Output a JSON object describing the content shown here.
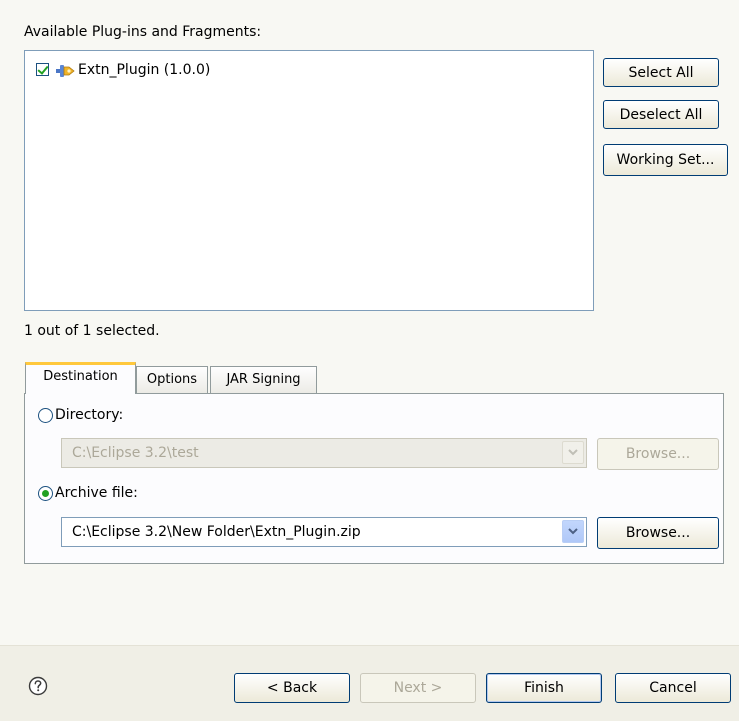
{
  "plugins": {
    "heading": "Available Plug-ins and Fragments:",
    "items": [
      {
        "label": "Extn_Plugin (1.0.0)",
        "checked": true
      }
    ],
    "selection_status": "1 out of 1 selected.",
    "buttons": {
      "select_all": "Select All",
      "deselect_all": "Deselect All",
      "working_set": "Working Set..."
    }
  },
  "tabs": {
    "items": [
      {
        "label": "Destination",
        "active": true
      },
      {
        "label": "Options"
      },
      {
        "label": "JAR Signing"
      }
    ],
    "destination": {
      "directory_label": "Directory:",
      "directory_value": "C:\\Eclipse 3.2\\test",
      "directory_browse": "Browse...",
      "archive_label": "Archive file:",
      "archive_value": "C:\\Eclipse 3.2\\New Folder\\Extn_Plugin.zip",
      "archive_browse": "Browse...",
      "selected": "archive"
    }
  },
  "footer": {
    "help_icon": "question-mark",
    "back": "< Back",
    "next": "Next >",
    "finish": "Finish",
    "cancel": "Cancel"
  },
  "colors": {
    "accent_check": "#21a121",
    "active_tab_top": "#ffc83c",
    "border": "#7f9db9"
  }
}
